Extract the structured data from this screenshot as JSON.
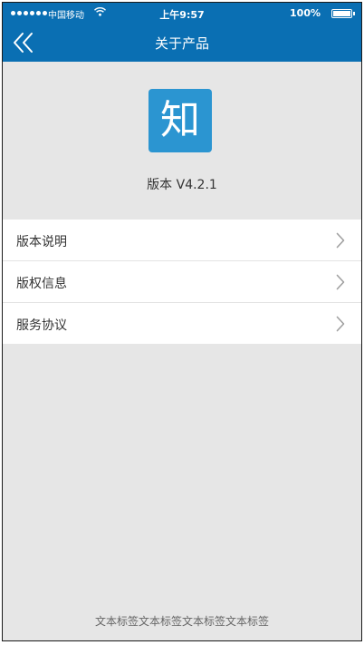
{
  "status_bar": {
    "carrier": "中国移动",
    "time": "上午9:57",
    "battery_percent": "100%"
  },
  "navbar": {
    "title": "关于产品",
    "back_icon": "double-chevron-left-icon"
  },
  "product": {
    "logo_char": "知",
    "version": "版本 V4.2.1"
  },
  "menu": {
    "items": [
      {
        "label": "版本说明",
        "icon": "chevron-right-icon"
      },
      {
        "label": "版权信息",
        "icon": "chevron-right-icon"
      },
      {
        "label": "服务协议",
        "icon": "chevron-right-icon"
      }
    ]
  },
  "footer": {
    "text": "文本标签文本标签文本标签文本标签"
  },
  "colors": {
    "primary": "#0a6fb3",
    "logo_bg": "#2b95d1",
    "background": "#e6e6e6"
  }
}
